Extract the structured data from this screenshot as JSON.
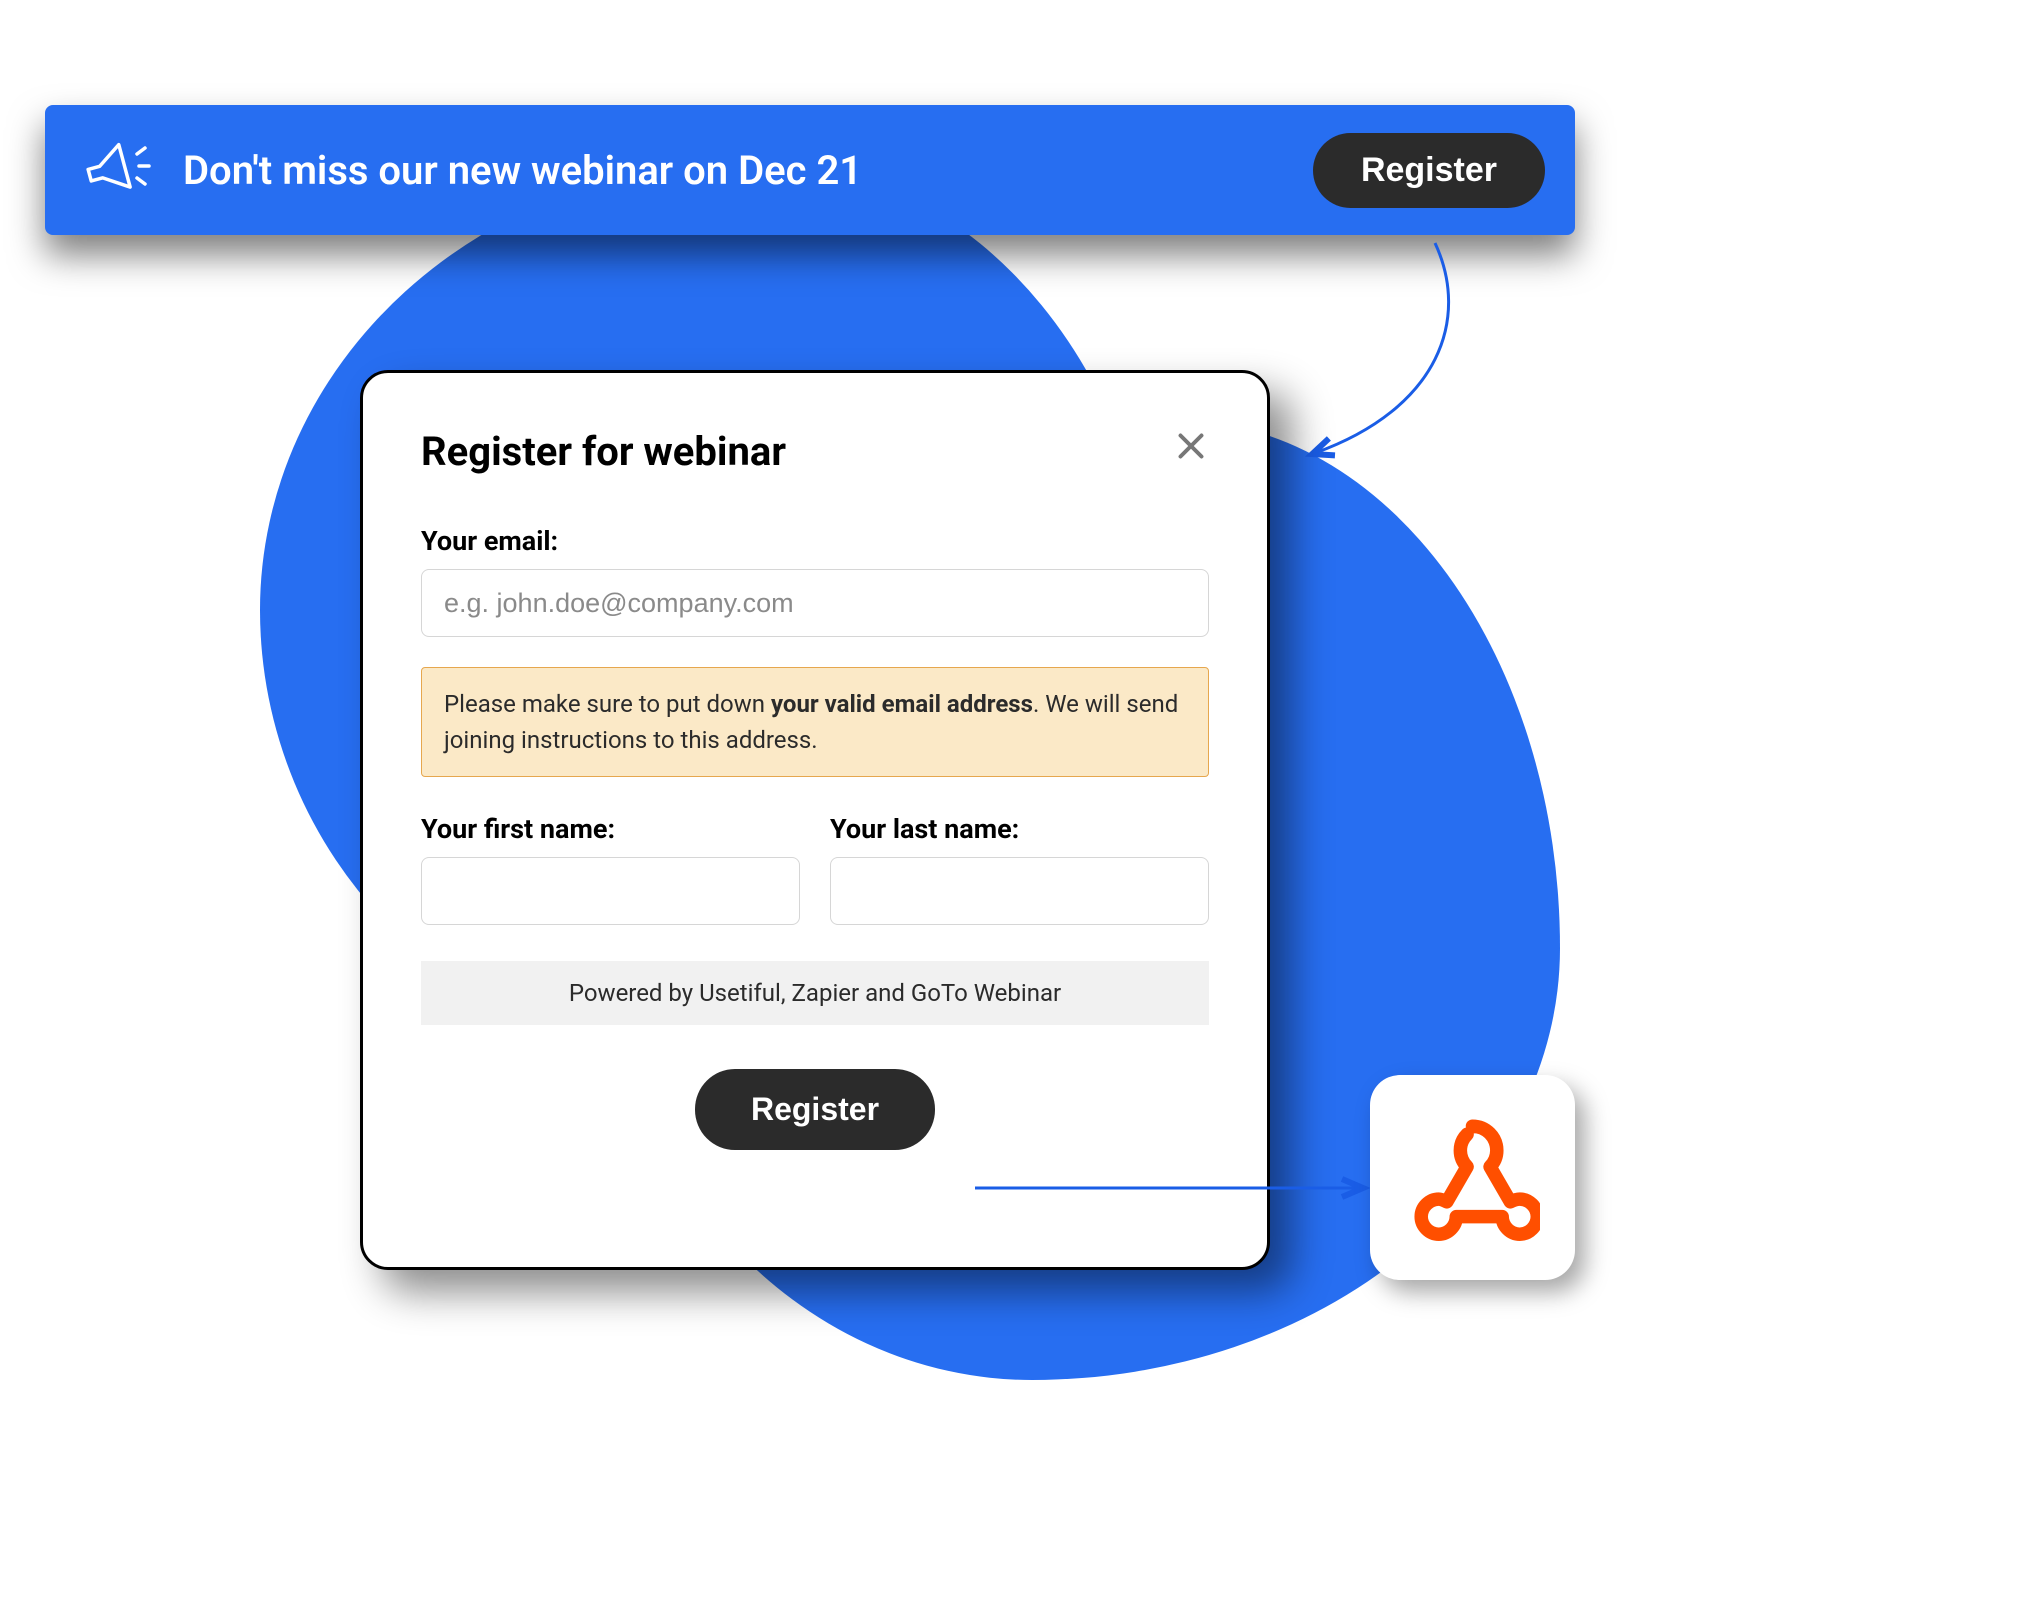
{
  "banner": {
    "text": "Don't miss our new webinar on Dec 21",
    "button_label": "Register"
  },
  "modal": {
    "title": "Register for webinar",
    "email": {
      "label": "Your email:",
      "placeholder": "e.g. john.doe@company.com",
      "value": ""
    },
    "notice": {
      "pre": "Please make sure to put down ",
      "bold": "your valid email address",
      "post": ". We will send joining instructions to this address."
    },
    "first_name": {
      "label": "Your first name:",
      "value": ""
    },
    "last_name": {
      "label": "Your last name:",
      "value": ""
    },
    "powered_by": "Powered by Usetiful, Zapier and GoTo Webinar",
    "submit_label": "Register"
  }
}
